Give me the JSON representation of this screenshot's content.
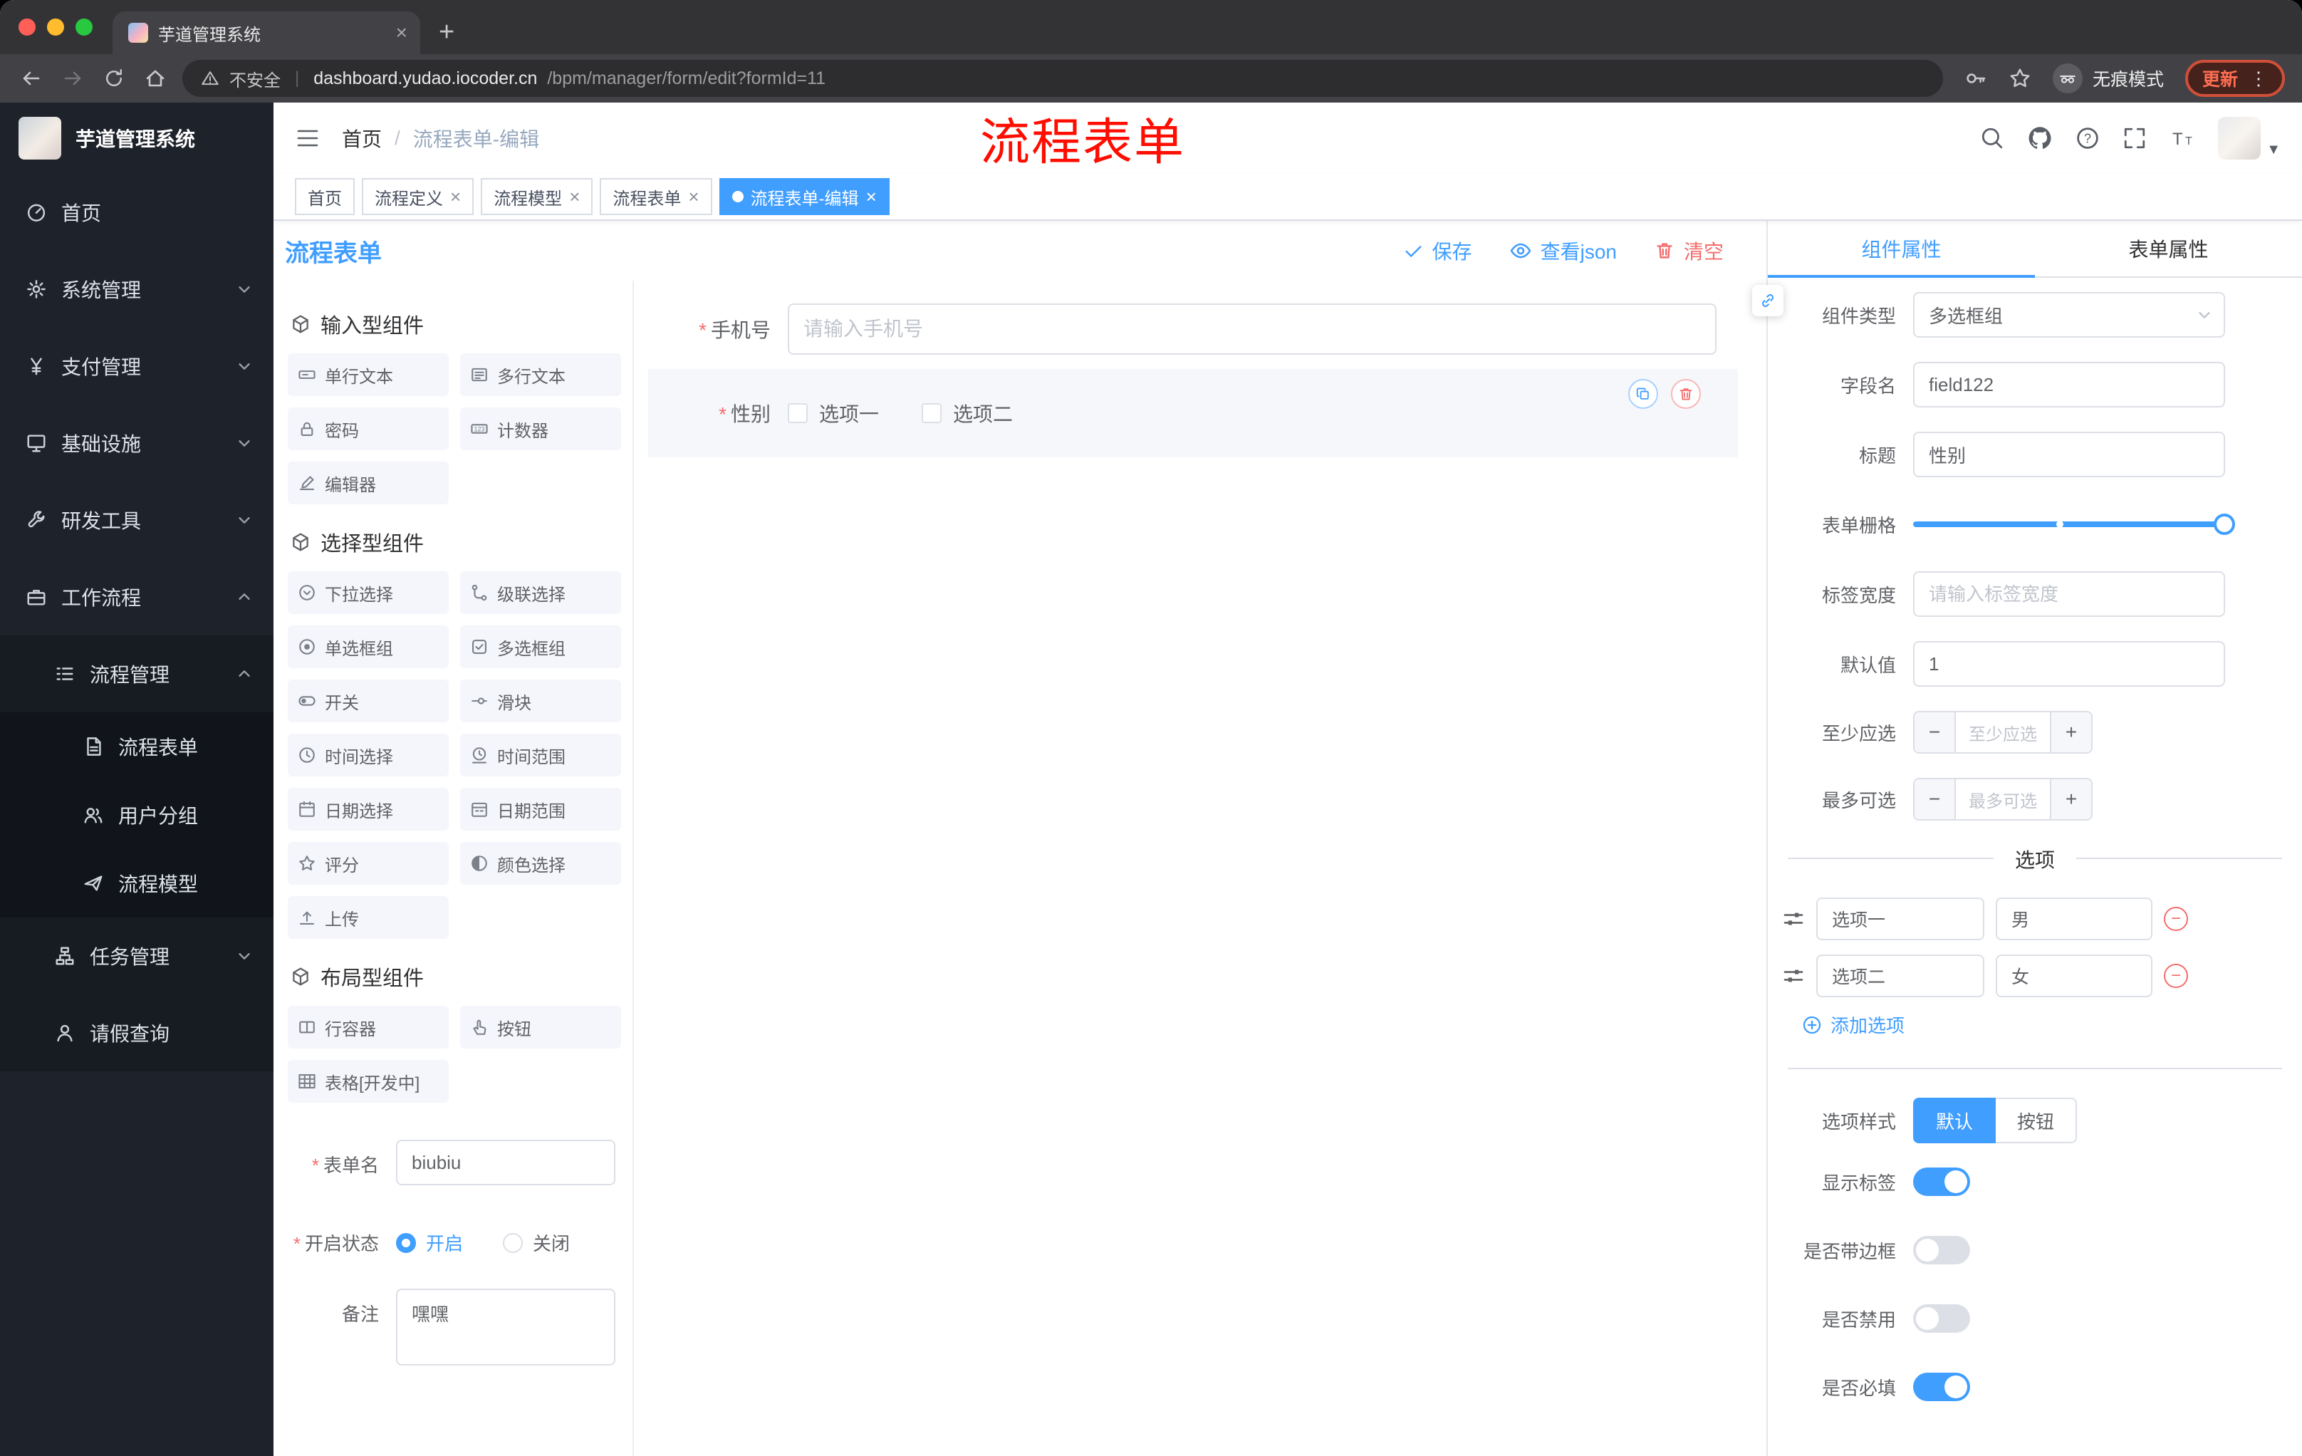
{
  "browser": {
    "tab_title": "芋道管理系统",
    "security_label": "不安全",
    "url_domain": "dashboard.yudao.iocoder.cn",
    "url_path": "/bpm/manager/form/edit?formId=11",
    "incognito_label": "无痕模式",
    "update_label": "更新"
  },
  "icons": {
    "close": "×",
    "new_tab": "+",
    "overflow_dots": "⋮",
    "breadcrumb_sep": "/",
    "minus": "−",
    "plus": "+",
    "avatar_caret": "▼"
  },
  "sidebar": {
    "brand": "芋道管理系统",
    "items": [
      {
        "label": "首页",
        "icon": "dashboard-icon"
      },
      {
        "label": "系统管理",
        "icon": "gear-icon"
      },
      {
        "label": "支付管理",
        "icon": "yen-icon"
      },
      {
        "label": "基础设施",
        "icon": "monitor-icon"
      },
      {
        "label": "研发工具",
        "icon": "wrench-icon"
      },
      {
        "label": "工作流程",
        "icon": "briefcase-icon"
      }
    ],
    "workflow_children": {
      "process_mgmt": {
        "label": "流程管理"
      },
      "process_form": {
        "label": "流程表单"
      },
      "user_group": {
        "label": "用户分组"
      },
      "process_model": {
        "label": "流程模型"
      },
      "task_mgmt": {
        "label": "任务管理"
      },
      "leave_query": {
        "label": "请假查询"
      }
    }
  },
  "header": {
    "breadcrumb": {
      "home": "首页",
      "current": "流程表单-编辑"
    },
    "annotation": "流程表单"
  },
  "tags": [
    {
      "label": "首页"
    },
    {
      "label": "流程定义"
    },
    {
      "label": "流程模型"
    },
    {
      "label": "流程表单"
    },
    {
      "label": "流程表单-编辑"
    }
  ],
  "designer": {
    "title": "流程表单",
    "save": "保存",
    "view_json": "查看json",
    "clear": "清空"
  },
  "palette": {
    "groups": [
      {
        "title": "输入型组件",
        "items": [
          {
            "label": "单行文本"
          },
          {
            "label": "多行文本"
          },
          {
            "label": "密码"
          },
          {
            "label": "计数器"
          },
          {
            "label": "编辑器"
          }
        ]
      },
      {
        "title": "选择型组件",
        "items": [
          {
            "label": "下拉选择"
          },
          {
            "label": "级联选择"
          },
          {
            "label": "单选框组"
          },
          {
            "label": "多选框组"
          },
          {
            "label": "开关"
          },
          {
            "label": "滑块"
          },
          {
            "label": "时间选择"
          },
          {
            "label": "时间范围"
          },
          {
            "label": "日期选择"
          },
          {
            "label": "日期范围"
          },
          {
            "label": "评分"
          },
          {
            "label": "颜色选择"
          },
          {
            "label": "上传"
          }
        ]
      },
      {
        "title": "布局型组件",
        "items": [
          {
            "label": "行容器"
          },
          {
            "label": "按钮"
          },
          {
            "label": "表格[开发中]"
          }
        ]
      }
    ]
  },
  "form_meta": {
    "name_label": "表单名",
    "name_value": "biubiu",
    "status_label": "开启状态",
    "status_on": "开启",
    "status_off": "关闭",
    "remark_label": "备注",
    "remark_value": "嘿嘿"
  },
  "canvas": {
    "phone_label": "手机号",
    "phone_placeholder": "请输入手机号",
    "gender_label": "性别",
    "gender_options": [
      {
        "label": "选项一"
      },
      {
        "label": "选项二"
      }
    ]
  },
  "props": {
    "tab_component": "组件属性",
    "tab_form": "表单属性",
    "type_label": "组件类型",
    "type_value": "多选框组",
    "field_label": "字段名",
    "field_value": "field122",
    "title_label": "标题",
    "title_value": "性别",
    "grid_label": "表单栅格",
    "label_width_label": "标签宽度",
    "label_width_placeholder": "请输入标签宽度",
    "default_label": "默认值",
    "default_value": "1",
    "min_label": "至少应选",
    "min_placeholder": "至少应选",
    "max_label": "最多可选",
    "max_placeholder": "最多可选",
    "options_title": "选项",
    "options": [
      {
        "name": "选项一",
        "value": "男"
      },
      {
        "name": "选项二",
        "value": "女"
      }
    ],
    "add_option": "添加选项",
    "style_label": "选项样式",
    "style_default": "默认",
    "style_button": "按钮",
    "show_label_label": "显示标签",
    "border_label": "是否带边框",
    "disabled_label": "是否禁用",
    "required_label": "是否必填"
  },
  "colors": {
    "primary": "#409eff",
    "danger": "#f56c6c",
    "annotation_red": "#fe0d00"
  }
}
